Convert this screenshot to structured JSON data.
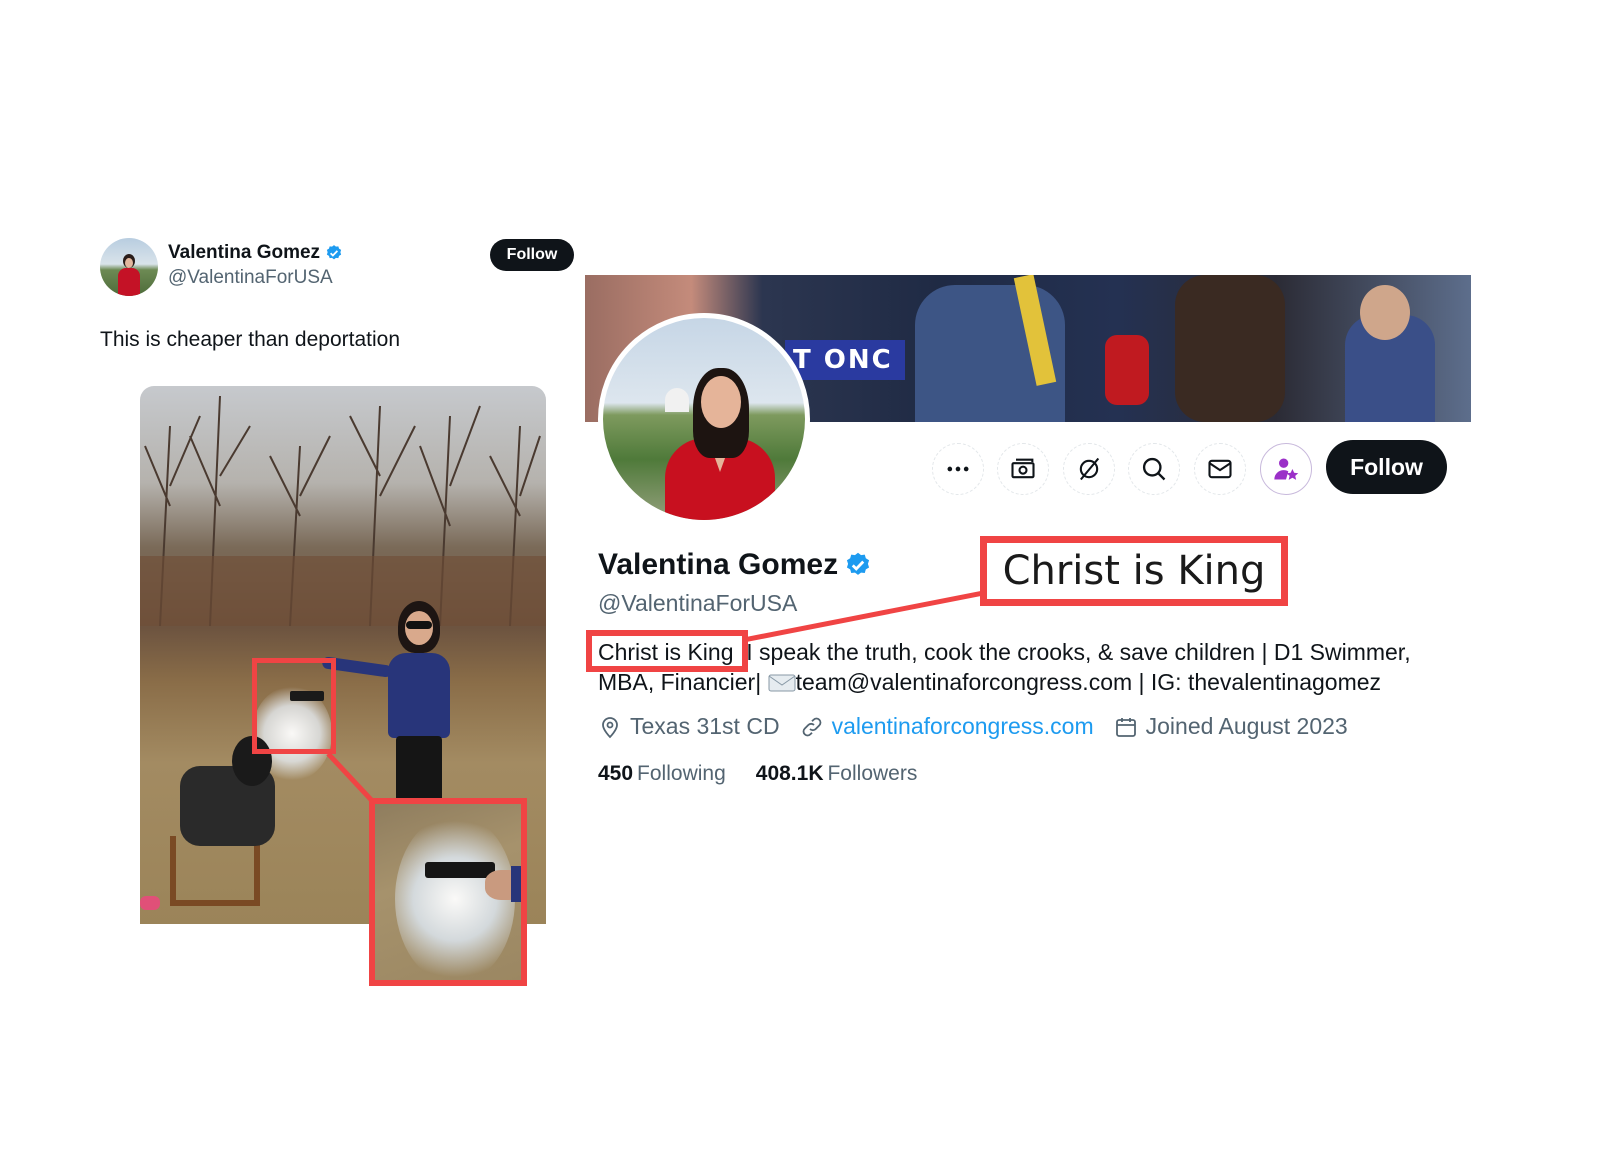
{
  "tweet": {
    "display_name": "Valentina Gomez",
    "handle": "@ValentinaForUSA",
    "follow_label": "Follow",
    "text": "This is cheaper than deportation"
  },
  "profile": {
    "display_name": "Valentina Gomez",
    "handle": "@ValentinaForUSA",
    "follow_label": "Follow",
    "banner_sign_text": "T ONC",
    "bio_line1": "Christ is King  I speak the truth, cook the crooks, & save children | D1 Swimmer,",
    "bio_line2_a": "MBA, Financier| ",
    "bio_line2_b": "team@valentinaforcongress.com | IG: thevalentinagomez",
    "location": "Texas 31st CD",
    "website": "valentinaforcongress.com",
    "joined": "Joined August 2023",
    "following_count": "450",
    "following_label": "Following",
    "followers_count": "408.1K",
    "followers_label": "Followers",
    "actions": [
      "more-icon",
      "subscribe-money-icon",
      "grok-icon",
      "search-icon",
      "message-icon",
      "subscribe-star-icon"
    ]
  },
  "annotation": {
    "callout_text": "Christ is King",
    "color": "#f04444"
  },
  "colors": {
    "verified": "#1d9bf0",
    "link": "#1d9bf0",
    "follow_bg": "#0f1419",
    "secondary_text": "#536471"
  }
}
